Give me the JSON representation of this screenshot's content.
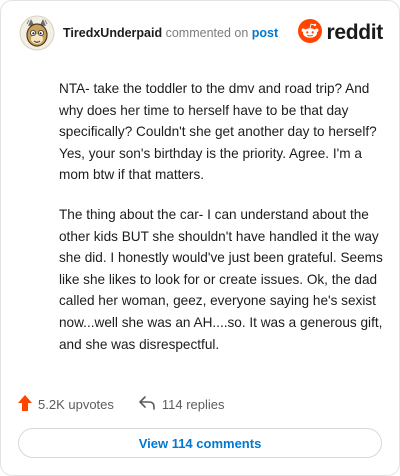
{
  "header": {
    "username": "TiredxUnderpaid",
    "action_text": "commented on",
    "post_link": "post",
    "brand": "reddit"
  },
  "comment": {
    "paragraphs": [
      "NTA- take the toddler to the dmv and road trip? And why does her time to herself have to be that day specifically? Couldn't she get another day to herself? Yes, your son's birthday is the priority. Agree. I'm a mom btw if that matters.",
      "The thing about the car- I can understand about the other kids BUT she shouldn't have handled it the way she did. I honestly would've just been grateful. Seems like she likes to look for or create issues. Ok, the dad called her woman, geez, everyone saying he's sexist now...well she was an AH....so. It was a generous gift, and she was disrespectful."
    ]
  },
  "footer": {
    "upvotes": "5.2K upvotes",
    "replies": "114 replies",
    "view_comments": "View 114 comments"
  },
  "colors": {
    "accent": "#0079d3",
    "upvote": "#ff4500",
    "brand": "#ff4500",
    "text": "#1c1c1c",
    "muted": "#7c7c7c"
  },
  "icons": {
    "avatar": "avatar-icon",
    "brand": "reddit-logo-icon",
    "upvote": "upvote-arrow-icon",
    "reply": "reply-arrow-icon"
  }
}
